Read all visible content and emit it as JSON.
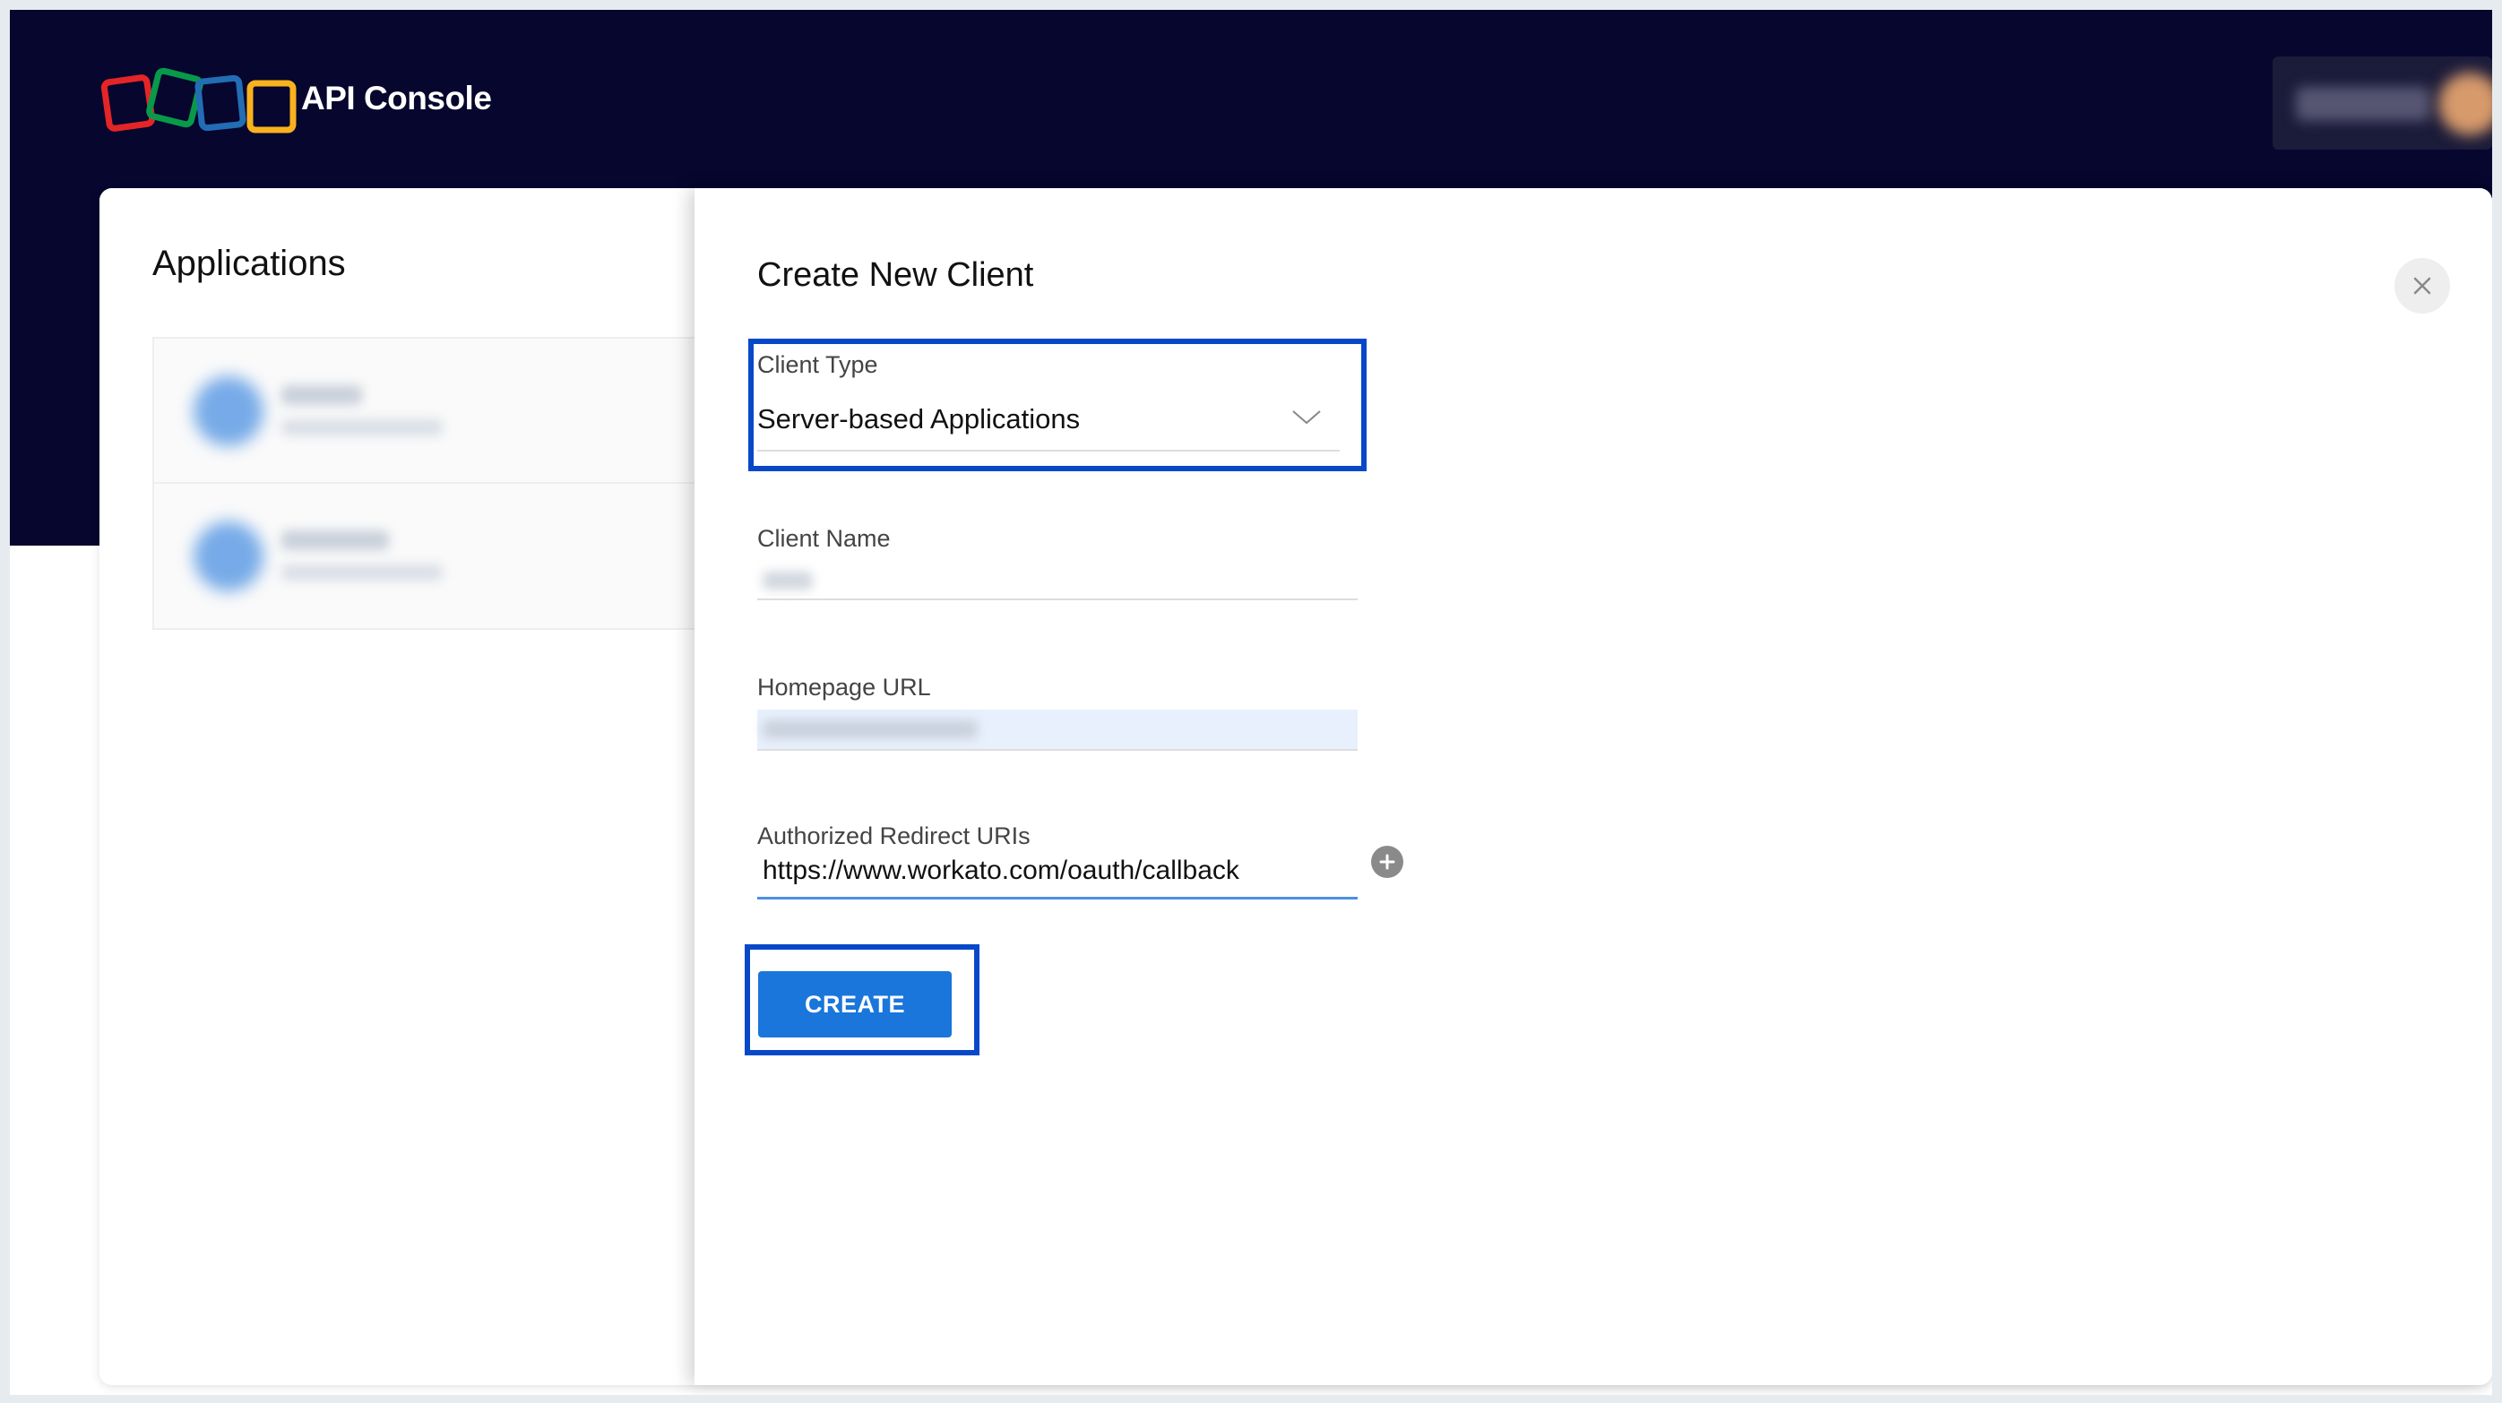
{
  "header": {
    "app_title": "API Console",
    "logo_colors": [
      "#e42527",
      "#089949",
      "#226db4",
      "#f9b21d"
    ]
  },
  "applications": {
    "title": "Applications"
  },
  "form": {
    "title": "Create New Client",
    "client_type": {
      "label": "Client Type",
      "value": "Server-based Applications"
    },
    "client_name": {
      "label": "Client Name"
    },
    "homepage_url": {
      "label": "Homepage URL"
    },
    "redirect_uris": {
      "label": "Authorized Redirect URIs",
      "value": "https://www.workato.com/oauth/callback"
    },
    "create_label": "CREATE"
  },
  "colors": {
    "header_bg": "#06062e",
    "primary_button": "#1a76db",
    "highlight": "#0748c9"
  }
}
